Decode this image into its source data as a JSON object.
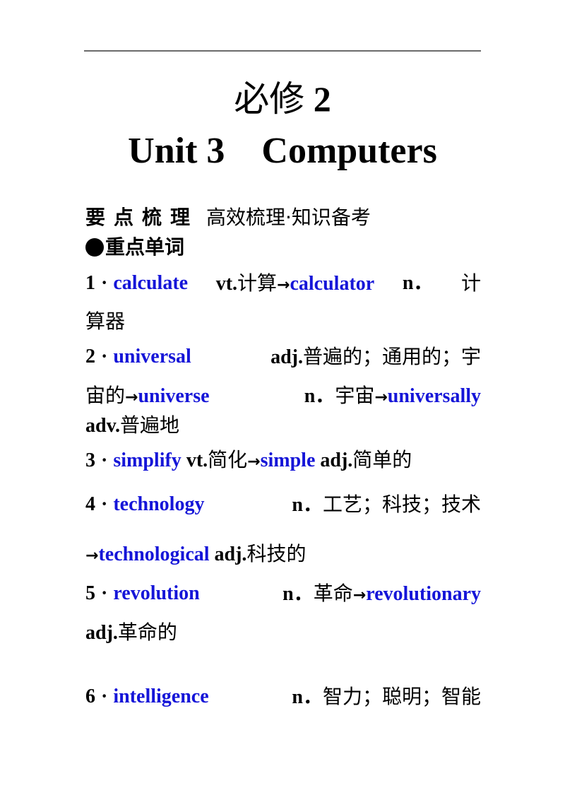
{
  "header": {
    "title_cn": "必修",
    "title_num": "2",
    "title_en": "Unit 3    Computers"
  },
  "section": {
    "label": "要点梳理",
    "label_chars": [
      "要",
      "点",
      "梳",
      "理"
    ],
    "subtitle": "高效梳理·知识备考",
    "sub_heading": "重点单词"
  },
  "colors": {
    "keyword": "#1515d8",
    "text": "#000000",
    "rule": "#6b6b6b"
  },
  "items": [
    {
      "num": "1",
      "word": "calculate",
      "pos": "vt.",
      "meaning": "计算",
      "derived": [
        {
          "word": "calculator",
          "pos": "n.",
          "meaning": "计算器"
        }
      ],
      "lines": [
        "1 · calculate  vt.计算→calculator  n．计",
        "算器"
      ]
    },
    {
      "num": "2",
      "word": "universal",
      "pos": "adj.",
      "meaning": "普遍的；通用的；宇宙的",
      "derived": [
        {
          "word": "universe",
          "pos": "n.",
          "meaning": "宇宙"
        },
        {
          "word": "universally",
          "pos": "adv.",
          "meaning": "普遍地"
        }
      ]
    },
    {
      "num": "3",
      "word": "simplify",
      "pos": "vt.",
      "meaning": "简化",
      "derived": [
        {
          "word": "simple",
          "pos": "adj.",
          "meaning": "简单的"
        }
      ]
    },
    {
      "num": "4",
      "word": "technology",
      "pos": "n.",
      "meaning": "工艺；科技；技术",
      "derived": [
        {
          "word": "technological",
          "pos": "adj.",
          "meaning": "科技的"
        }
      ]
    },
    {
      "num": "5",
      "word": "revolution",
      "pos": "n.",
      "meaning": "革命",
      "derived": [
        {
          "word": "revolutionary",
          "pos": "adj.",
          "meaning": "革命的"
        }
      ]
    },
    {
      "num": "6",
      "word": "intelligence",
      "pos": "n.",
      "meaning": "智力；聪明；智能",
      "derived": []
    }
  ],
  "text": {
    "dot": "·",
    "arrow": "→",
    "n_full": "n．",
    "i1_meaning_a": "计",
    "i1_meaning_b": "算器",
    "i2_meaning_a": "普遍的；通用的；宇",
    "i2_meaning_b": "宙的",
    "i2_d1_meaning": "宇宙",
    "i2_d2_meaning": "普遍地"
  }
}
